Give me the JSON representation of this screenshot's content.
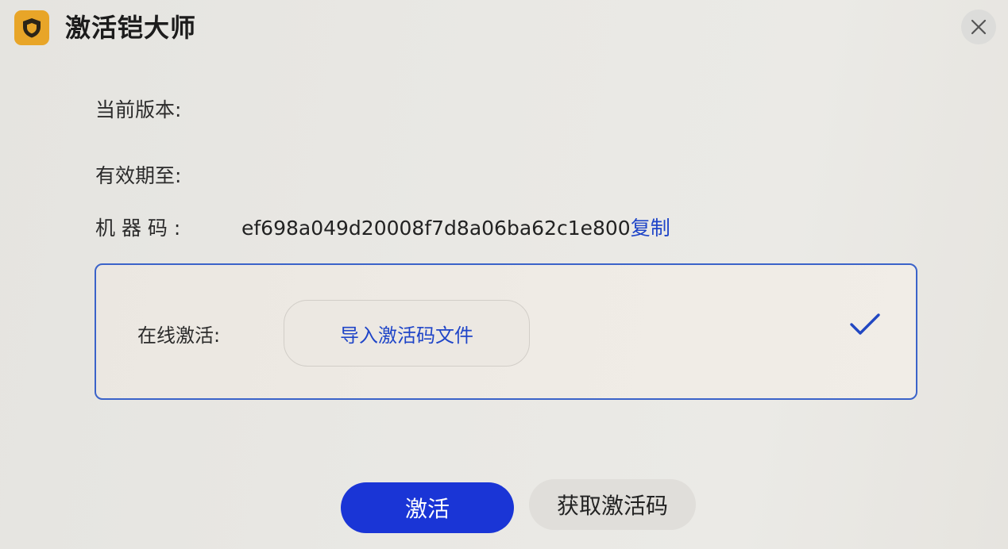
{
  "window": {
    "title": "激活铠大师",
    "app_icon": "shield-icon",
    "close_icon": "close-icon"
  },
  "info": {
    "version_label": "当前版本:",
    "expiry_label": "有效期至:",
    "machine_code_label": "机 器 码 :",
    "machine_code_value": "ef698a049d20008f7d8a06ba62c1e800",
    "copy_label": "复制"
  },
  "online_activation": {
    "label": "在线激活:",
    "import_button_label": "导入激活码文件",
    "status_icon": "check-icon"
  },
  "actions": {
    "activate_label": "激活",
    "get_code_label": "获取激活码"
  },
  "colors": {
    "accent": "#1a35d6",
    "link": "#1f45c8",
    "panel_border": "#3b63c9",
    "app_icon_bg": "#e8a528"
  }
}
